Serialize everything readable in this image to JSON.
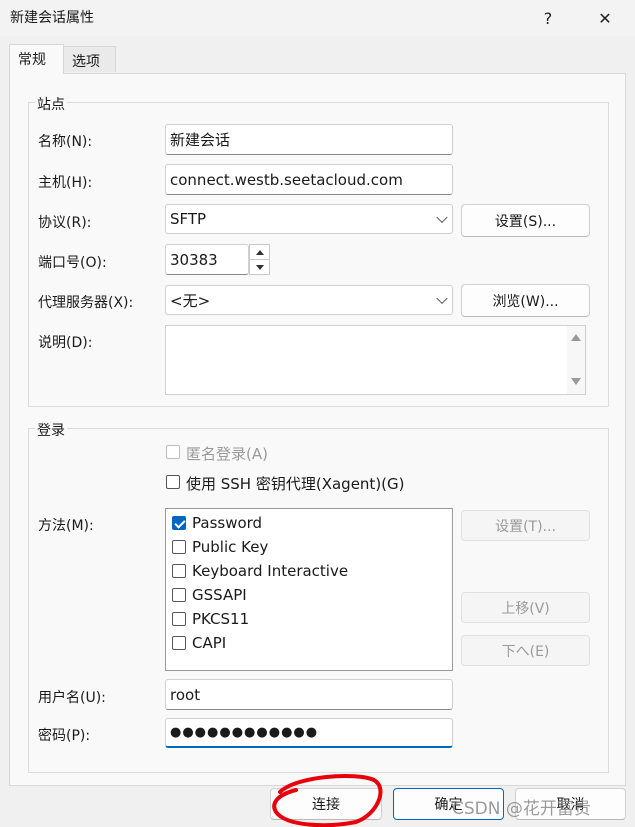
{
  "window": {
    "title": "新建会话属性",
    "help": "?",
    "close": "✕"
  },
  "tabs": [
    {
      "label": "常规"
    },
    {
      "label": "选项"
    }
  ],
  "site": {
    "group_title": "站点",
    "name_label": "名称(N):",
    "name_value": "新建会话",
    "host_label": "主机(H):",
    "host_value": "connect.westb.seetacloud.com",
    "protocol_label": "协议(R):",
    "protocol_value": "SFTP",
    "settings_button": "设置(S)...",
    "port_label": "端口号(O):",
    "port_value": "30383",
    "proxy_label": "代理服务器(X):",
    "proxy_value": "<无>",
    "browse_button": "浏览(W)...",
    "desc_label": "说明(D):",
    "desc_value": ""
  },
  "login": {
    "group_title": "登录",
    "anonymous_label": "匿名登录(A)",
    "ssh_agent_label": "使用 SSH 密钥代理(Xagent)(G)",
    "method_label": "方法(M):",
    "methods": [
      {
        "label": "Password",
        "checked": true
      },
      {
        "label": "Public Key",
        "checked": false
      },
      {
        "label": "Keyboard Interactive",
        "checked": false
      },
      {
        "label": "GSSAPI",
        "checked": false
      },
      {
        "label": "PKCS11",
        "checked": false
      },
      {
        "label": "CAPI",
        "checked": false
      }
    ],
    "method_settings_button": "设置(T)...",
    "move_up_button": "上移(V)",
    "move_down_button": "下へ(E)",
    "username_label": "用户名(U):",
    "username_value": "root",
    "password_label": "密码(P):",
    "password_value": "●●●●●●●●●●●●"
  },
  "footer": {
    "connect_button": "连接",
    "ok_button": "确定",
    "cancel_button": "取消",
    "watermark": "CSDN @花开富贵"
  }
}
